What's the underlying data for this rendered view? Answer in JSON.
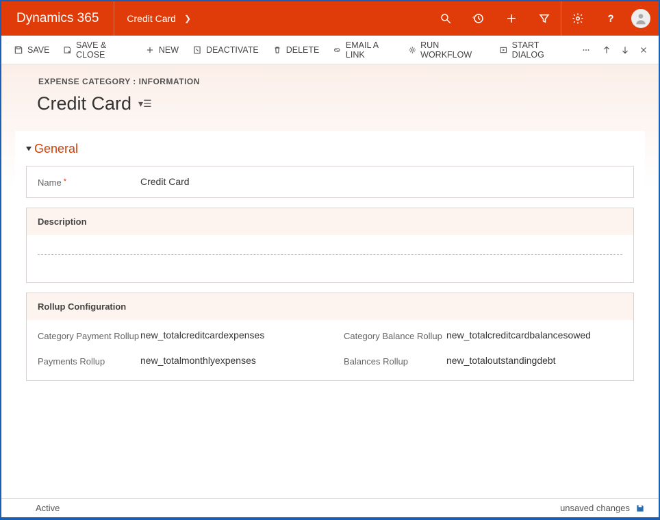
{
  "brand": "Dynamics 365",
  "breadcrumb": "Credit Card",
  "cmdbar": {
    "save": "SAVE",
    "saveclose": "SAVE & CLOSE",
    "new": "NEW",
    "deactivate": "DEACTIVATE",
    "delete": "DELETE",
    "emaillink": "EMAIL A LINK",
    "runworkflow": "RUN WORKFLOW",
    "startdialog": "START DIALOG"
  },
  "form": {
    "type": "EXPENSE CATEGORY : INFORMATION",
    "title": "Credit Card"
  },
  "section_general": "General",
  "fields": {
    "name_label": "Name",
    "name_value": "Credit Card",
    "desc_header": "Description",
    "rollup_header": "Rollup Configuration",
    "cat_pay_label": "Category Payment Rollup",
    "cat_pay_value": "new_totalcreditcardexpenses",
    "pay_label": "Payments Rollup",
    "pay_value": "new_totalmonthlyexpenses",
    "cat_bal_label": "Category Balance Rollup",
    "cat_bal_value": "new_totalcreditcardbalancesowed",
    "bal_label": "Balances Rollup",
    "bal_value": "new_totaloutstandingdebt"
  },
  "status": {
    "left": "Active",
    "right": "unsaved changes"
  }
}
